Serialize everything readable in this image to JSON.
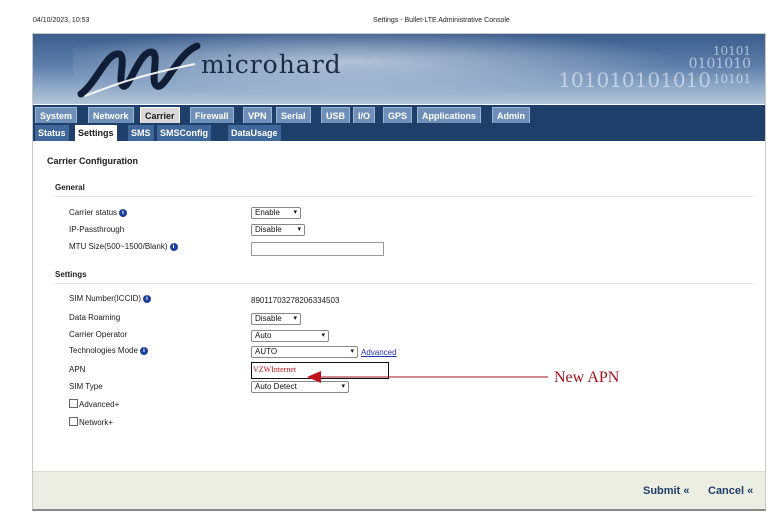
{
  "print_header": {
    "datetime": "04/10/2023, 10:53",
    "title": "Settings - Bullet-LTE Administrative Console"
  },
  "brand": {
    "name": "microhard"
  },
  "banner": {
    "binary_rows": [
      "10101",
      "0101010",
      "101010101010",
      "10101"
    ]
  },
  "nav": {
    "main_tabs": [
      "System",
      "Network",
      "Carrier",
      "Firewall",
      "VPN",
      "Serial",
      "USB",
      "I/O",
      "GPS",
      "Applications",
      "Admin"
    ],
    "main_active": "Carrier",
    "sub_tabs": [
      "Status",
      "Settings",
      "SMS",
      "SMSConfig",
      "DataUsage"
    ],
    "sub_active": "Settings"
  },
  "page": {
    "title": "Carrier Configuration"
  },
  "general": {
    "title": "General",
    "carrier_status": {
      "label": "Carrier status",
      "value": "Enable"
    },
    "ip_passthrough": {
      "label": "IP-Passthrough",
      "value": "Disable"
    },
    "mtu_size": {
      "label": "MTU Size(500~1500/Blank)",
      "value": ""
    }
  },
  "settings": {
    "title": "Settings",
    "sim_number": {
      "label": "SIM Number(ICCID)",
      "value": "89011703278206334503"
    },
    "data_roaming": {
      "label": "Data Roaming",
      "value": "Disable"
    },
    "carrier_operator": {
      "label": "Carrier Operator",
      "value": "Auto"
    },
    "technologies_mode": {
      "label": "Technologies Mode",
      "value": "AUTO",
      "link": "Advanced"
    },
    "apn": {
      "label": "APN",
      "value": "VZWInternet"
    },
    "sim_type": {
      "label": "SIM Type",
      "value": "Auto Detect"
    },
    "advanced_checkbox": {
      "label": "Advanced+",
      "checked": false
    },
    "network_checkbox": {
      "label": "Network+",
      "checked": false
    }
  },
  "footer": {
    "submit_label": "Submit «",
    "cancel_label": "Cancel «"
  },
  "annotation": {
    "text": "New APN",
    "color": "#a0141c"
  },
  "colors": {
    "nav_bar": "#1f3f6b",
    "tab_inactive": "#6e8fb7",
    "subtab_inactive": "#40679a",
    "info_icon": "#1c3f9a",
    "footer_bg": "#eceee3"
  }
}
